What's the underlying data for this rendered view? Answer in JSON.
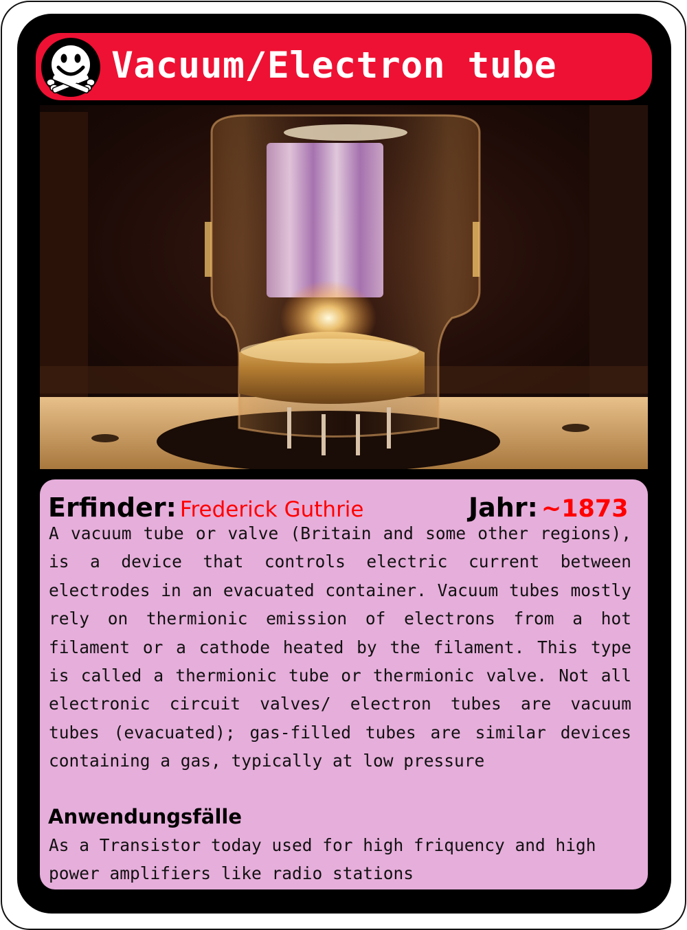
{
  "card": {
    "title": "Vacuum/Electron tube",
    "logo_icon": "smiley-skull-icon",
    "photo_subject": "glowing-vacuum-tube-photo",
    "inventor_label": "Erfinder:",
    "inventor_value": "Frederick Guthrie",
    "year_label": "Jahr:",
    "year_value": "~1873",
    "description": "A vacuum tube  or valve (Britain and some other regions), is a device that controls electric current between electrodes in an evacuated container. Vacuum tubes mostly rely on thermionic emission of electrons from a hot filament or a cathode heated by the filament. This type is called a thermionic tube or thermionic valve. Not all electronic circuit valves/ electron tubes are vacuum tubes (evacuated); gas-filled tubes are similar devices containing a gas, typically at low pressure",
    "uses_label": "Anwendungsfälle",
    "uses_text": "As a Transistor today used for high friquency and high power amplifiers like radio stations"
  },
  "colors": {
    "title_bar": "#ee1133",
    "info_panel": "#e6aedb",
    "frame": "#000000",
    "accent_text": "#ff0000"
  }
}
